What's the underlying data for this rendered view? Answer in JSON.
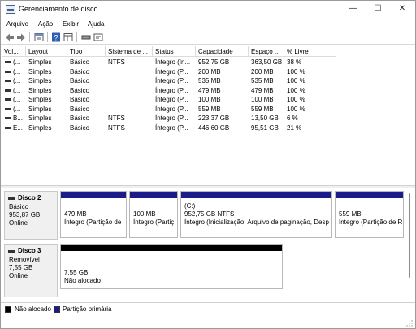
{
  "window": {
    "title": "Gerenciamento de disco",
    "minimize_glyph": "—",
    "maximize_glyph": "☐",
    "close_glyph": "✕"
  },
  "menu": {
    "items": [
      "Arquivo",
      "Ação",
      "Exibir",
      "Ajuda"
    ]
  },
  "toolbar": {
    "buttons": [
      "back-arrow-icon",
      "forward-arrow-icon",
      "properties-icon",
      "help-icon",
      "list-view-icon",
      "drive-icon",
      "console-icon"
    ]
  },
  "volume_list": {
    "headers": [
      "Vol...",
      "Layout",
      "Tipo",
      "Sistema de ...",
      "Status",
      "Capacidade",
      "Espaço ...",
      "% Livre"
    ],
    "rows": [
      {
        "vol": "(...",
        "layout": "Simples",
        "tipo": "Básico",
        "fs": "NTFS",
        "status": "Íntegro (In...",
        "cap": "952,75 GB",
        "free": "363,50 GB",
        "pct": "38 %"
      },
      {
        "vol": "(...",
        "layout": "Simples",
        "tipo": "Básico",
        "fs": "",
        "status": "Íntegro (P...",
        "cap": "200 MB",
        "free": "200 MB",
        "pct": "100 %"
      },
      {
        "vol": "(...",
        "layout": "Simples",
        "tipo": "Básico",
        "fs": "",
        "status": "Íntegro (P...",
        "cap": "535 MB",
        "free": "535 MB",
        "pct": "100 %"
      },
      {
        "vol": "(...",
        "layout": "Simples",
        "tipo": "Básico",
        "fs": "",
        "status": "Íntegro (P...",
        "cap": "479 MB",
        "free": "479 MB",
        "pct": "100 %"
      },
      {
        "vol": "(...",
        "layout": "Simples",
        "tipo": "Básico",
        "fs": "",
        "status": "Íntegro (P...",
        "cap": "100 MB",
        "free": "100 MB",
        "pct": "100 %"
      },
      {
        "vol": "(...",
        "layout": "Simples",
        "tipo": "Básico",
        "fs": "",
        "status": "Íntegro (P...",
        "cap": "559 MB",
        "free": "559 MB",
        "pct": "100 %"
      },
      {
        "vol": "B...",
        "layout": "Simples",
        "tipo": "Básico",
        "fs": "NTFS",
        "status": "Íntegro (P...",
        "cap": "223,37 GB",
        "free": "13,50 GB",
        "pct": "6 %"
      },
      {
        "vol": "E...",
        "layout": "Simples",
        "tipo": "Básico",
        "fs": "NTFS",
        "status": "Íntegro (P...",
        "cap": "446,60 GB",
        "free": "95,51 GB",
        "pct": "21 %"
      }
    ]
  },
  "disks": [
    {
      "name": "Disco 2",
      "type": "Básico",
      "size": "953,87 GB",
      "state": "Online",
      "partitions": [
        {
          "line1": "",
          "line2": "479 MB",
          "line3": "Íntegro (Partição de",
          "bar_color": "#1b1b8a"
        },
        {
          "line1": "",
          "line2": "100 MB",
          "line3": "Íntegro (Partiç",
          "bar_color": "#1b1b8a"
        },
        {
          "line1": "(C:)",
          "line2": "952,75 GB NTFS",
          "line3": "Íntegro (Inicialização, Arquivo de paginação, Desp",
          "bar_color": "#1b1b8a"
        },
        {
          "line1": "",
          "line2": "559 MB",
          "line3": "Íntegro (Partição de R",
          "bar_color": "#1b1b8a"
        }
      ]
    },
    {
      "name": "Disco 3",
      "type": "Removível",
      "size": "7,55 GB",
      "state": "Online",
      "partitions": [
        {
          "line1": "",
          "line2": "7,55 GB",
          "line3": "Não alocado",
          "bar_color": "#000000"
        }
      ]
    }
  ],
  "legend": {
    "unallocated": "Não alocado",
    "primary": "Partição primária",
    "unallocated_color": "#000000",
    "primary_color": "#1b1b8a"
  }
}
